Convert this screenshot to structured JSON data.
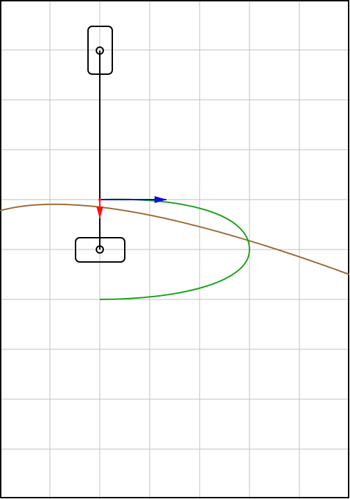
{
  "colors": {
    "background": "#ffffff",
    "grid": "#bfbfbf",
    "frame": "#000000",
    "bogie_bodies": "#000000",
    "rod": "#000000",
    "trajectory_large": "#9a6a35",
    "trajectory_small": "#1aa31a",
    "arrow_velocity": "#1010d0",
    "arrow_force": "#ff1010"
  },
  "icons": {
    "upper_body": "rounded-rectangle",
    "lower_body": "rounded-rectangle",
    "pivot": "circle",
    "arrow_velocity": "blue-arrow",
    "arrow_force": "red-arrow"
  }
}
